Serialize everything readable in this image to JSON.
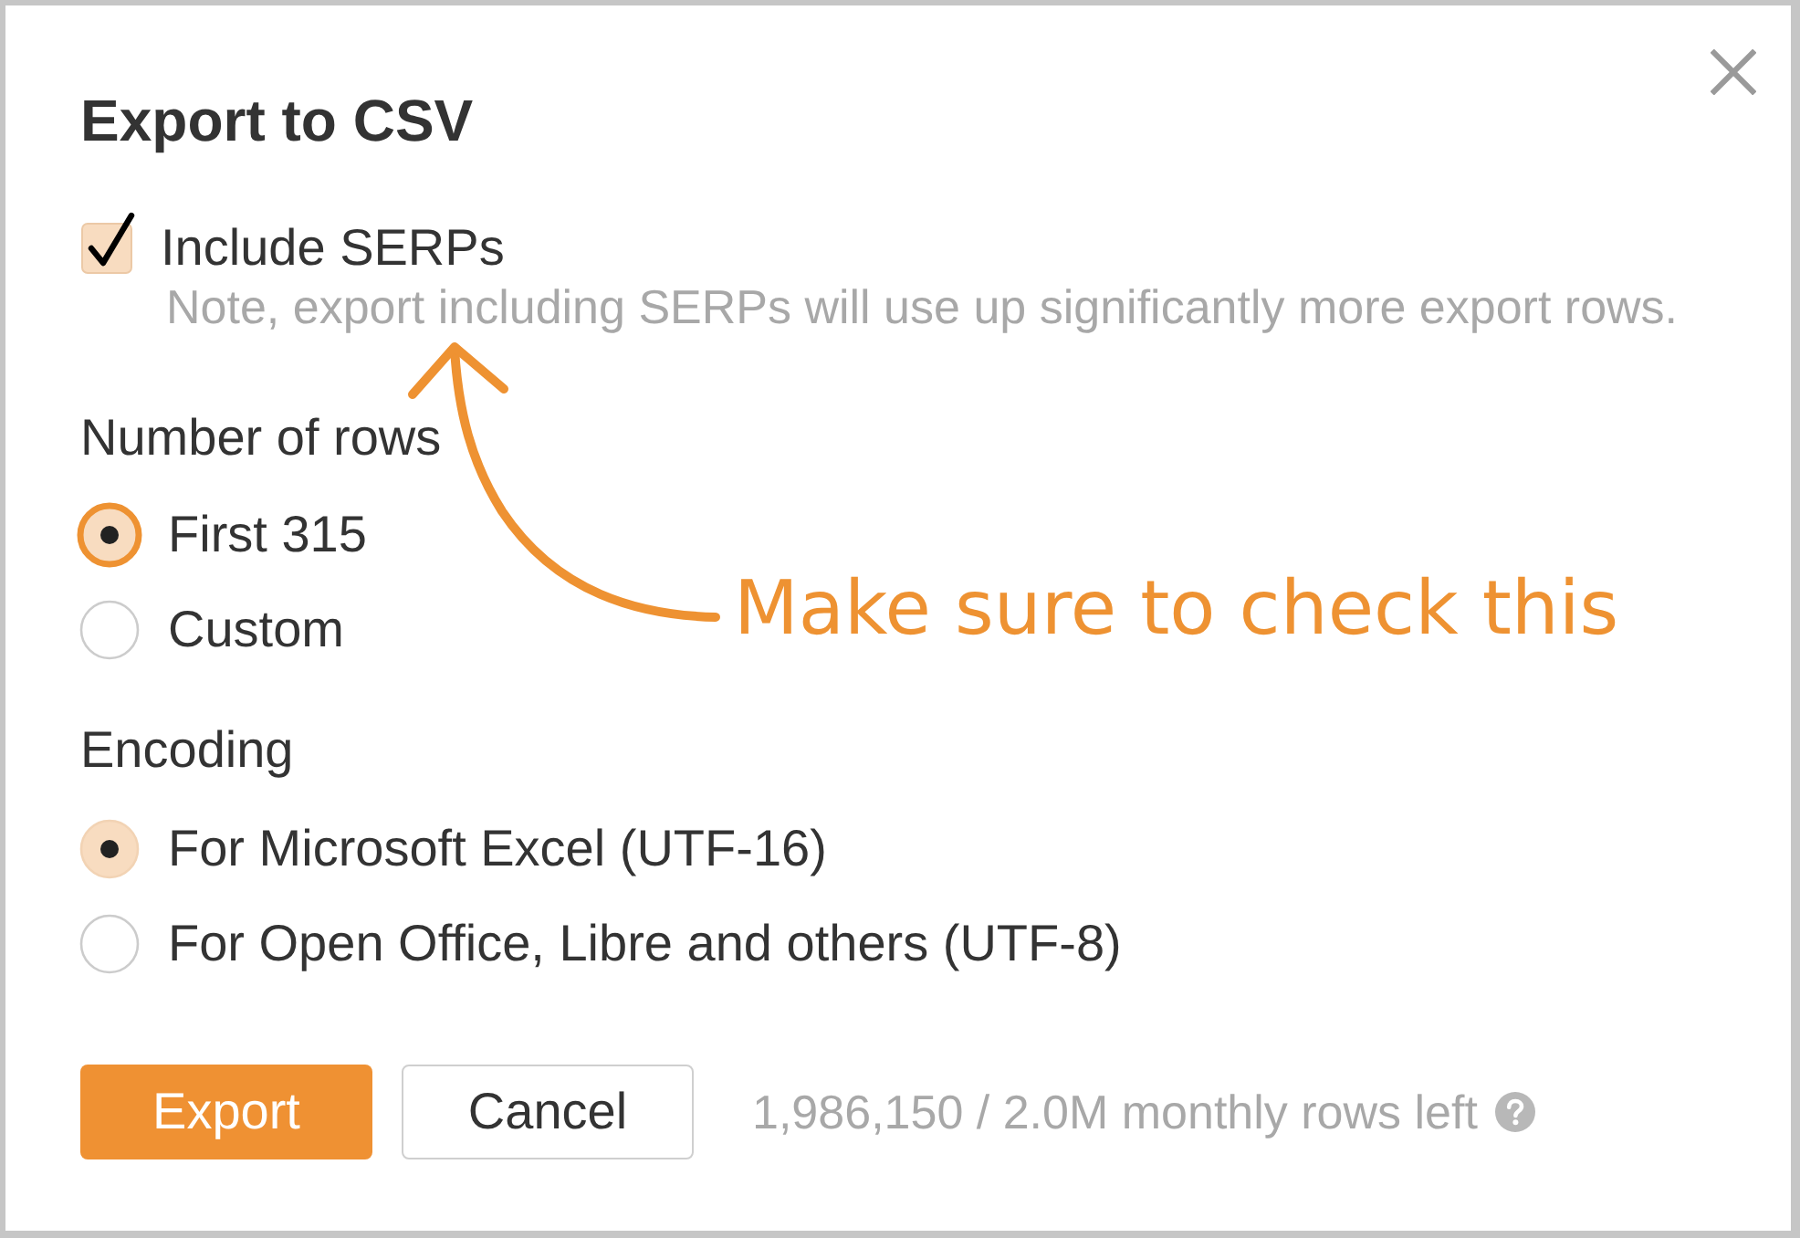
{
  "dialog": {
    "title": "Export to CSV",
    "include_serps": {
      "label": "Include SERPs",
      "checked": true,
      "note": "Note, export including SERPs will use up significantly more export rows."
    },
    "row_count": {
      "heading": "Number of rows",
      "options": [
        {
          "label": "First 315",
          "selected": true,
          "focused": true
        },
        {
          "label": "Custom",
          "selected": false,
          "focused": false
        }
      ]
    },
    "encoding": {
      "heading": "Encoding",
      "options": [
        {
          "label": "For Microsoft Excel (UTF-16)",
          "selected": true,
          "focused": false
        },
        {
          "label": "For Open Office, Libre and others (UTF-8)",
          "selected": false,
          "focused": false
        }
      ]
    },
    "buttons": [
      {
        "label": "Export",
        "kind": "primary"
      },
      {
        "label": "Cancel",
        "kind": "secondary"
      }
    ],
    "quota": "1,986,150 / 2.0M monthly rows left"
  },
  "annotation": {
    "text": "Make sure to check this"
  }
}
